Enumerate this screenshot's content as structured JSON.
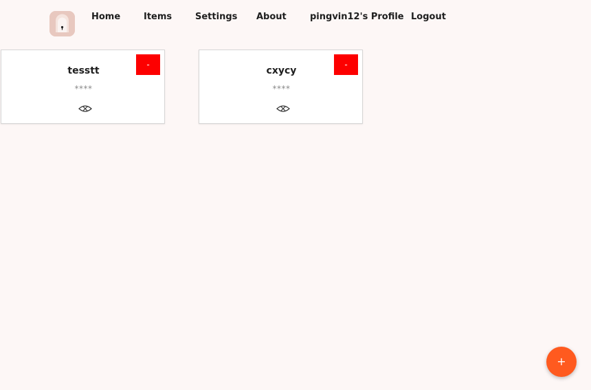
{
  "nav": {
    "home": "Home",
    "items": "Items",
    "settings": "Settings",
    "about": "About",
    "profile": "pingvin12's Profile",
    "logout": "Logout"
  },
  "logo_icon": "lock-icon",
  "cards": [
    {
      "title": "tesstt",
      "masked": "****",
      "delete_label": "-",
      "icon": "eye-hidden-icon"
    },
    {
      "title": "cxycy",
      "masked": "****",
      "delete_label": "-",
      "icon": "eye-hidden-icon"
    }
  ],
  "fab": {
    "label": "+"
  },
  "colors": {
    "background": "#fdf7f6",
    "delete": "#fd0000",
    "fab": "#ff5a1f",
    "logo_bg": "#e8c8bf"
  }
}
